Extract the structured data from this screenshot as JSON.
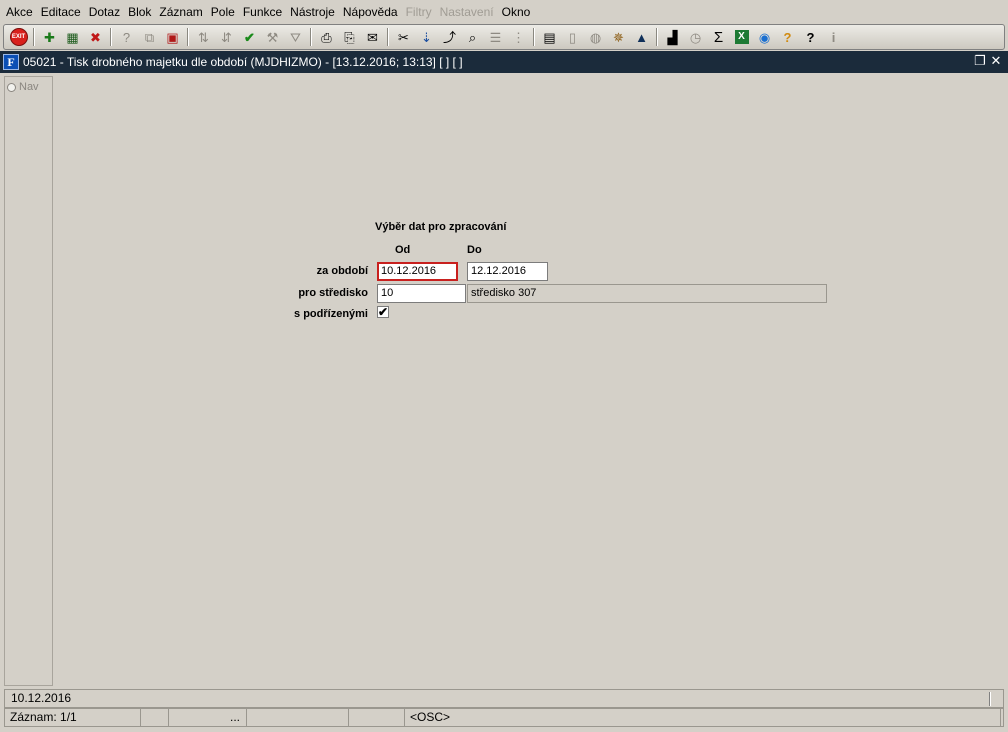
{
  "menu": [
    {
      "label": "Akce",
      "disabled": false
    },
    {
      "label": "Editace",
      "disabled": false
    },
    {
      "label": "Dotaz",
      "disabled": false
    },
    {
      "label": "Blok",
      "disabled": false
    },
    {
      "label": "Záznam",
      "disabled": false
    },
    {
      "label": "Pole",
      "disabled": false
    },
    {
      "label": "Funkce",
      "disabled": false
    },
    {
      "label": "Nástroje",
      "disabled": false
    },
    {
      "label": "Nápověda",
      "disabled": false
    },
    {
      "label": "Filtry",
      "disabled": true
    },
    {
      "label": "Nastavení",
      "disabled": true
    },
    {
      "label": "Okno",
      "disabled": false
    }
  ],
  "toolbar": {
    "exit_label": "EXIT",
    "icons": [
      "new-record-icon",
      "save-record-icon",
      "delete-record-icon",
      "query-enter-icon",
      "query-execute-icon",
      "query-cancel-icon",
      "sort-asc-icon",
      "sort-desc-icon",
      "commit-check-icon",
      "wrench-icon",
      "filter-icon",
      "print-icon",
      "print-preview-icon",
      "mail-icon",
      "cut-icon",
      "copy-icon",
      "paste-icon",
      "lookup-icon",
      "list-icon",
      "tree-icon",
      "clipboard-icon",
      "document-icon",
      "globe-icon",
      "ship-wheel-icon",
      "mountain-icon",
      "chart-icon",
      "clock-icon",
      "sigma-icon",
      "excel-icon",
      "browser-icon",
      "help-context-icon",
      "help-icon",
      "info-icon"
    ]
  },
  "window": {
    "title": "05021 - Tisk drobného majetku dle období (MJDHIZMO) - [13.12.2016; 13:13]  [ ]  [ ]",
    "app_icon_text": "F"
  },
  "nav": {
    "label": "Nav"
  },
  "form": {
    "heading": "Výběr dat pro zpracování",
    "col_from": "Od",
    "col_to": "Do",
    "period_label": "za období",
    "period_from": "10.12.2016",
    "period_to": "12.12.2016",
    "center_label": "pro středisko",
    "center_code": "10",
    "center_name": "středisko 307",
    "subordinates_label": "s podřízenými",
    "subordinates_checked": "✔"
  },
  "hint": {
    "text": "10.12.2016"
  },
  "status": {
    "record": "Záznam: 1/1",
    "ellipsis": "...",
    "mode": "<OSC>"
  }
}
